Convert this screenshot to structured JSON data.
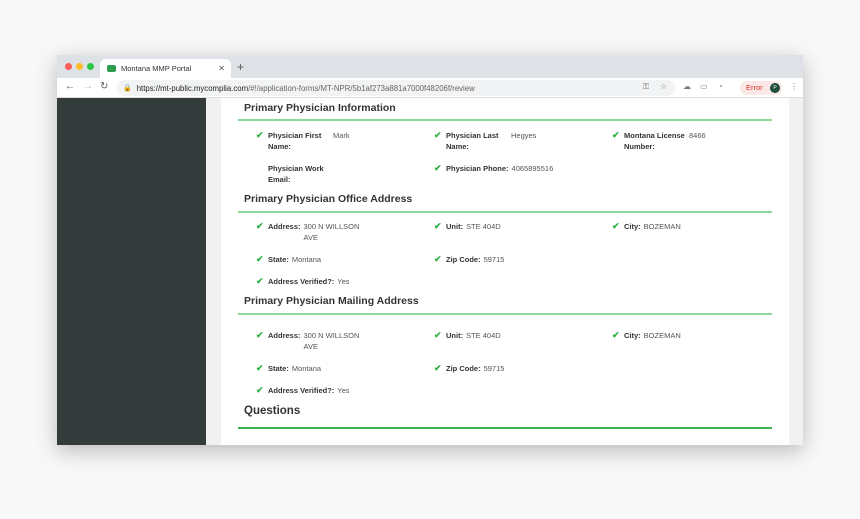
{
  "browser": {
    "tab_title": "Montana MMP Portal",
    "url_host": "https://mt-public.mycomplia.com",
    "url_path": "/#!/application-forms/MT-NPR/5b1af273a881a7000f48206f/review",
    "error_label": "Error",
    "avatar_initial": "P"
  },
  "sections": [
    {
      "title": "Primary Physician Information",
      "fields": [
        {
          "label": "Physician First Name:",
          "value": "Mark",
          "checked": true
        },
        {
          "label": "Physician Last Name:",
          "value": "Hegyes",
          "checked": true
        },
        {
          "label": "Montana License Number:",
          "value": "8466",
          "checked": true
        },
        {
          "label": "Physician Work Email:",
          "value": "",
          "checked": false
        },
        {
          "label": "Physician Phone:",
          "value": "4065895516",
          "checked": true
        }
      ]
    },
    {
      "title": "Primary Physician Office Address",
      "fields": [
        {
          "label": "Address:",
          "value": "300 N WILLSON AVE",
          "checked": true
        },
        {
          "label": "Unit:",
          "value": "STE 404D",
          "checked": true
        },
        {
          "label": "City:",
          "value": "BOZEMAN",
          "checked": true
        },
        {
          "label": "State:",
          "value": "Montana",
          "checked": true
        },
        {
          "label": "Zip Code:",
          "value": "59715",
          "checked": true
        },
        {
          "label": "Address Verified?:",
          "value": "Yes",
          "checked": true
        }
      ]
    },
    {
      "title": "Primary Physician Mailing Address",
      "fields": [
        {
          "label": "Address:",
          "value": "300 N WILLSON AVE",
          "checked": true
        },
        {
          "label": "Unit:",
          "value": "STE 404D",
          "checked": true
        },
        {
          "label": "City:",
          "value": "BOZEMAN",
          "checked": true
        },
        {
          "label": "State:",
          "value": "Montana",
          "checked": true
        },
        {
          "label": "Zip Code:",
          "value": "59715",
          "checked": true
        },
        {
          "label": "Address Verified?:",
          "value": "Yes",
          "checked": true
        }
      ]
    },
    {
      "title": "Questions",
      "fields": []
    }
  ],
  "colors": {
    "check": "#2fb344",
    "sidebar": "#333b3b",
    "rule": "#8ed89a"
  }
}
